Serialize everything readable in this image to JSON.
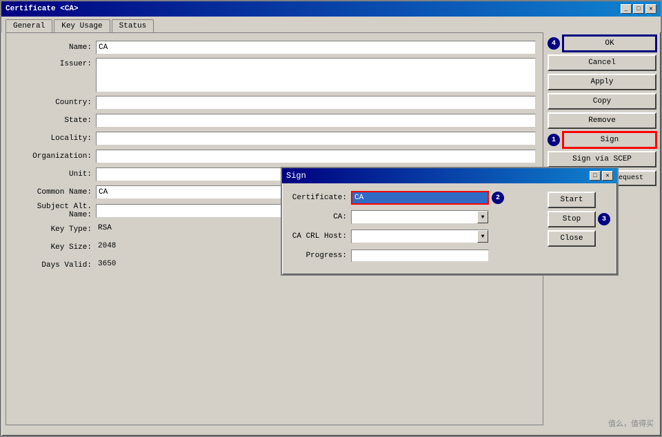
{
  "mainWindow": {
    "title": "Certificate <CA>",
    "titleButtons": [
      "minimize",
      "maximize",
      "close"
    ]
  },
  "tabs": [
    {
      "label": "General",
      "active": true
    },
    {
      "label": "Key Usage",
      "active": false
    },
    {
      "label": "Status",
      "active": false
    }
  ],
  "buttons": {
    "ok": "OK",
    "cancel": "Cancel",
    "apply": "Apply",
    "copy": "Copy",
    "remove": "Remove",
    "sign": "Sign",
    "signViaScep": "Sign via SCEP",
    "createCertRequest": "Create Cert. Request"
  },
  "badges": {
    "ok_badge": "4",
    "sign_badge": "1"
  },
  "formFields": {
    "name_label": "Name:",
    "name_value": "CA",
    "issuer_label": "Issuer:",
    "issuer_value": "",
    "country_label": "Country:",
    "country_value": "",
    "state_label": "State:",
    "state_value": "",
    "locality_label": "Locality:",
    "locality_value": "",
    "organization_label": "Organization:",
    "organization_value": "",
    "unit_label": "Unit:",
    "unit_value": "",
    "commonName_label": "Common Name:",
    "commonName_value": "CA",
    "subjectAltName_label": "Subject Alt. Name:",
    "subjectAltName_value": "",
    "keyType_label": "Key Type:",
    "keyType_value": "RSA",
    "keySize_label": "Key Size:",
    "keySize_value": "2048",
    "daysValid_label": "Days Valid:",
    "daysValid_value": "3650"
  },
  "signDialog": {
    "title": "Sign",
    "certificate_label": "Certificate:",
    "certificate_value": "CA",
    "ca_label": "CA:",
    "ca_value": "",
    "caCrlHost_label": "CA CRL Host:",
    "caCrlHost_value": "",
    "progress_label": "Progress:",
    "buttons": {
      "start": "Start",
      "stop": "Stop",
      "close": "Close"
    },
    "badges": {
      "cert_badge": "2",
      "stop_badge": "3"
    }
  },
  "watermark": "值么，值得买"
}
